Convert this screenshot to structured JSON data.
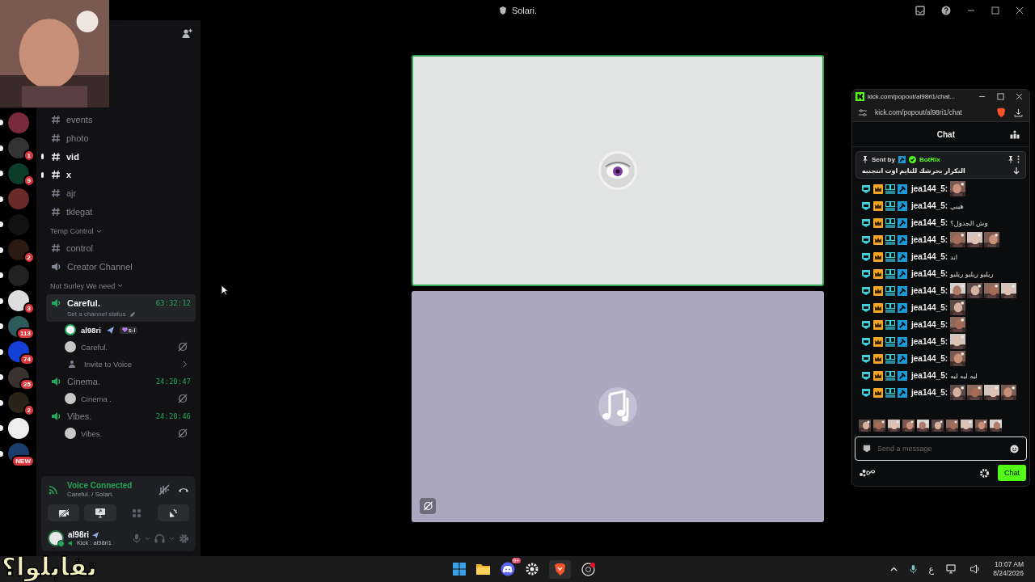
{
  "window": {
    "title": "Solari."
  },
  "servers": [
    {
      "unread": true
    },
    {
      "unread": true,
      "badge": "1"
    },
    {
      "unread": true,
      "badge": "9"
    },
    {
      "unread": true
    },
    {
      "unread": true
    },
    {
      "unread": true,
      "badge": "2"
    },
    {
      "unread": true
    },
    {
      "unread": true,
      "badge": "3"
    },
    {
      "unread": true,
      "badge": "113"
    },
    {
      "unread": true,
      "badge": "74"
    },
    {
      "unread": true,
      "badge": "25"
    },
    {
      "unread": true,
      "badge": "2"
    },
    {
      "unread": true
    },
    {
      "unread": true,
      "badge": "NEW"
    }
  ],
  "channels": [
    {
      "kind": "text",
      "name": "events",
      "unread": false
    },
    {
      "kind": "text",
      "name": "photo",
      "unread": false
    },
    {
      "kind": "text",
      "name": "vid",
      "unread": true
    },
    {
      "kind": "text",
      "name": "x",
      "unread": true
    },
    {
      "kind": "text",
      "name": "ajr",
      "unread": false
    },
    {
      "kind": "text",
      "name": "tklegat",
      "unread": false
    },
    {
      "kind": "category",
      "name": "Temp Control"
    },
    {
      "kind": "text",
      "name": "control",
      "unread": false
    },
    {
      "kind": "voice",
      "name": "Creator Channel",
      "active": false,
      "selected": false
    },
    {
      "kind": "category",
      "name": "Not Surley We need"
    },
    {
      "kind": "voice",
      "name": "Careful.",
      "active": true,
      "selected": true,
      "timer": "63:32:12",
      "status": "Set a channel status",
      "children": [
        {
          "kind": "user",
          "name": "al98ri",
          "tag": "s-i"
        },
        {
          "kind": "stream",
          "name": "Careful."
        },
        {
          "kind": "invite",
          "name": "Invite to Voice"
        }
      ]
    },
    {
      "kind": "voice",
      "name": "Cinema.",
      "active": true,
      "selected": false,
      "timer": "24:20:47",
      "children": [
        {
          "kind": "stream",
          "name": "Cinema ."
        }
      ]
    },
    {
      "kind": "voice",
      "name": "Vibes.",
      "active": true,
      "selected": false,
      "timer": "24:20:46",
      "children": [
        {
          "kind": "stream",
          "name": "Vibes."
        }
      ]
    }
  ],
  "voice_panel": {
    "title": "Voice Connected",
    "location": "Careful. / Solari."
  },
  "user_panel": {
    "name": "al98ri",
    "status": "Kick : al98ri1"
  },
  "tiles": [
    {
      "kind": "avatar",
      "speaking": true,
      "camera_off": false
    },
    {
      "kind": "music",
      "speaking": false,
      "camera_off": true
    }
  ],
  "chat_window": {
    "title": "kick.com/popout/al98ri1/chat...",
    "url": "kick.com/popout/al98ri1/chat",
    "header": "Chat",
    "pinned": {
      "label": "Sent by",
      "author": "BotRix",
      "text": "التكرار بحرشك للتايم اوت انتجنبه"
    },
    "messages": [
      {
        "kind": "emotes",
        "user": "jea144_5:"
      },
      {
        "kind": "text",
        "user": "jea144_5:",
        "text": "هيبي"
      },
      {
        "kind": "text",
        "user": "jea144_5:",
        "text": "وش الجدول؟"
      },
      {
        "kind": "emotes",
        "user": "jea144_5:"
      },
      {
        "kind": "text",
        "user": "jea144_5:",
        "text": "اند"
      },
      {
        "kind": "text",
        "user": "jea144_5:",
        "text": "ريليو ريليو ريليو"
      },
      {
        "kind": "emotes",
        "user": "jea144_5:"
      },
      {
        "kind": "emotes",
        "user": "jea144_5:"
      },
      {
        "kind": "emotes",
        "user": "jea144_5:"
      },
      {
        "kind": "emotes",
        "user": "jea144_5:"
      },
      {
        "kind": "emotes",
        "user": "jea144_5:"
      },
      {
        "kind": "text",
        "user": "jea144_5:",
        "text": "ليه ليه ليه"
      },
      {
        "kind": "emotes",
        "user": "jea144_5:"
      }
    ],
    "input": {
      "placeholder": "Send a message"
    },
    "send_button": "Chat"
  },
  "caption": "تقابلوا؟",
  "taskbar": {
    "discord_badge": "9+",
    "language": "ع",
    "time": "10:07 AM",
    "date": "8/24/2026"
  }
}
